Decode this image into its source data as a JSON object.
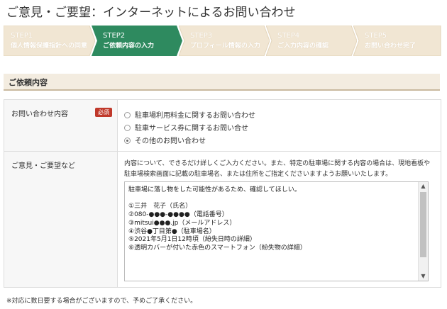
{
  "page": {
    "title": "ご意見・ご要望：インターネットによるお問い合わせ"
  },
  "steps": [
    {
      "num": "STEP1",
      "label": "個人情報保護指針への同意"
    },
    {
      "num": "STEP2",
      "label": "ご依頼内容の入力"
    },
    {
      "num": "STEP3",
      "label": "プロフィール情報の入力"
    },
    {
      "num": "STEP4",
      "label": "ご入力内容の確認"
    },
    {
      "num": "STEP5",
      "label": "お問い合わせ完了"
    }
  ],
  "active_step": 2,
  "section": {
    "title": "ご依頼内容"
  },
  "form": {
    "inquiry": {
      "label": "お問い合わせ内容",
      "required_badge": "必須",
      "options": [
        {
          "label": "駐車場利用料金に関するお問い合わせ",
          "selected": false
        },
        {
          "label": "駐車サービス券に関するお問い合せ",
          "selected": false
        },
        {
          "label": "その他のお問い合わせ",
          "selected": true
        }
      ]
    },
    "comments": {
      "label": "ご意見・ご要望など",
      "description": "内容について、できるだけ詳しくご入力ください。また、特定の駐車場に関する内容の場合は、現地看板や駐車場検索画面に記載の駐車場名、または住所をご指定くださいますようお願いいたします。",
      "value": "駐車場に落し物をした可能性があるため、確認してほしい。\n\n①三井　花子（氏名）\n②080-●●●-●●●●（電話番号）\n③mitsui●●●.jp（メールアドレス）\n④渋谷●丁目第●（駐車場名）\n⑤2021年5月1日12時頃（紛失日時の詳細）\n⑥透明カバーが付いた赤色のスマートフォン（紛失物の詳細）"
    }
  },
  "footer_note": "※対応に数日要する場合がございますので、予めご了承ください。",
  "colors": {
    "active_step": "#2e8a5f",
    "inactive_step": "#f1e6d3",
    "required": "#c0392b",
    "section_bg": "#f3ece0"
  },
  "icons": {
    "scroll_up": "▲",
    "scroll_down": "▼"
  }
}
